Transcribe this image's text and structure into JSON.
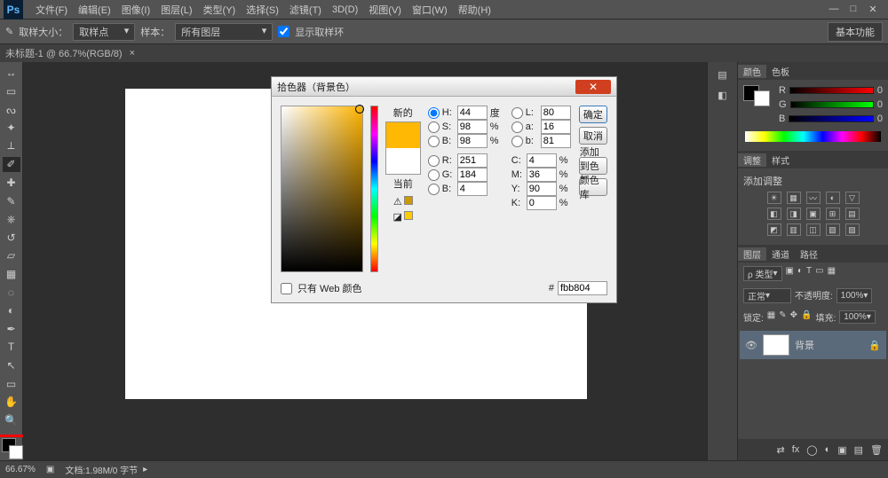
{
  "menu": {
    "items": [
      "文件(F)",
      "编辑(E)",
      "图像(I)",
      "图层(L)",
      "类型(Y)",
      "选择(S)",
      "滤镜(T)",
      "3D(D)",
      "视图(V)",
      "窗口(W)",
      "帮助(H)"
    ]
  },
  "optbar": {
    "label1": "取样大小：",
    "dd1": "取样点",
    "label2": "样本：",
    "dd2": "所有图层",
    "check": "显示取样环",
    "rightchip": "基本功能"
  },
  "doc": {
    "title": "未标题-1 @ 66.7%(RGB/8)"
  },
  "panels": {
    "color": {
      "tab1": "颜色",
      "tab2": "色板",
      "r": "R",
      "g": "G",
      "b": "B",
      "rv": "0",
      "gv": "0",
      "bv": "0"
    },
    "adjust": {
      "tab1": "调整",
      "tab2": "样式",
      "label": "添加调整"
    },
    "layers": {
      "tab1": "图层",
      "tab2": "通道",
      "tab3": "路径",
      "kind": "ρ 类型",
      "blend": "正常",
      "opacityLabel": "不透明度:",
      "opacity": "100%",
      "lockLabel": "锁定:",
      "fillLabel": "填充:",
      "fill": "100%",
      "layerName": "背景"
    }
  },
  "status": {
    "zoom": "66.67%",
    "info": "文档:1.98M/0 字节"
  },
  "picker": {
    "title": "拾色器（背景色）",
    "newLabel": "新的",
    "curLabel": "当前",
    "buttons": {
      "ok": "确定",
      "cancel": "取消",
      "add": "添加到色板",
      "lib": "颜色库"
    },
    "fields": {
      "H": {
        "l": "H:",
        "v": "44",
        "u": "度"
      },
      "S": {
        "l": "S:",
        "v": "98",
        "u": "%"
      },
      "Bv": {
        "l": "B:",
        "v": "98",
        "u": "%"
      },
      "R": {
        "l": "R:",
        "v": "251"
      },
      "G": {
        "l": "G:",
        "v": "184"
      },
      "B": {
        "l": "B:",
        "v": "4"
      },
      "L": {
        "l": "L:",
        "v": "80"
      },
      "a": {
        "l": "a:",
        "v": "16"
      },
      "b": {
        "l": "b:",
        "v": "81"
      },
      "C": {
        "l": "C:",
        "v": "4",
        "u": "%"
      },
      "M": {
        "l": "M:",
        "v": "36",
        "u": "%"
      },
      "Y": {
        "l": "Y:",
        "v": "90",
        "u": "%"
      },
      "K": {
        "l": "K:",
        "v": "0",
        "u": "%"
      }
    },
    "webonly": "只有 Web 颜色",
    "hexLabel": "#",
    "hex": "fbb804"
  }
}
